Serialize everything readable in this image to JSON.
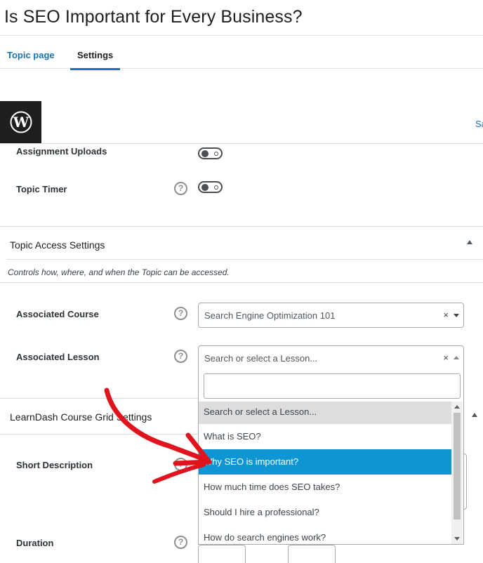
{
  "page": {
    "title": "Is SEO Important for Every Business?"
  },
  "tabs": [
    {
      "label": "Topic page"
    },
    {
      "label": "Settings"
    }
  ],
  "toolbar": {
    "save_label": "Sa"
  },
  "settings": {
    "assignment_uploads": {
      "label": "Assignment Uploads",
      "enabled": false
    },
    "topic_timer": {
      "label": "Topic Timer",
      "enabled": false
    }
  },
  "access_section": {
    "title": "Topic Access Settings",
    "description": "Controls how, where, and when the Topic can be accessed.",
    "associated_course": {
      "label": "Associated Course",
      "value": "Search Engine Optimization 101",
      "clear": "×"
    },
    "associated_lesson": {
      "label": "Associated Lesson",
      "placeholder": "Search or select a Lesson...",
      "clear": "×",
      "search_value": "",
      "options": [
        "Search or select a Lesson...",
        "What is SEO?",
        "Why SEO is important?",
        "How much time does SEO takes?",
        "Should I hire a professional?",
        "How do search engines work?"
      ],
      "highlighted": "Why SEO is important?"
    }
  },
  "grid_section": {
    "title": "LearnDash Course Grid Settings",
    "short_description": {
      "label": "Short Description"
    },
    "duration": {
      "label": "Duration"
    }
  },
  "colors": {
    "accent": "#1873b5",
    "highlight": "#0e95d4",
    "annotation_arrow": "#e0141e"
  },
  "icons": {
    "logo": "wordpress-logo",
    "help": "question-circle-icon",
    "collapse": "caret-up-icon"
  }
}
